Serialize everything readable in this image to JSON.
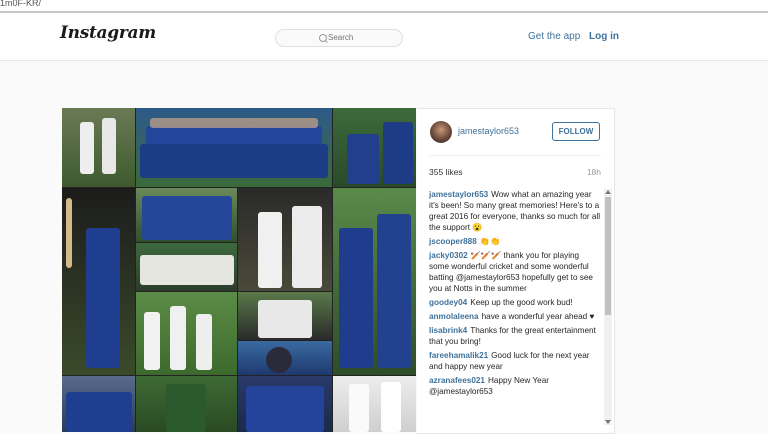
{
  "browser": {
    "url_fragment": "1m0F-KR/"
  },
  "header": {
    "logo": "Instagram",
    "search_placeholder": "Search",
    "get_app": "Get the app",
    "login": "Log in"
  },
  "post": {
    "username": "jamestaylor653",
    "follow_label": "FOLLOW",
    "likes": "355 likes",
    "age": "18h",
    "comments": [
      {
        "user": "jamestaylor653",
        "text": "Wow what an amazing year it's been! So many great memories! Here's to a great 2016 for everyone, thanks so much for all the support 😮"
      },
      {
        "user": "jscooper888",
        "text": "👏👏"
      },
      {
        "user": "jacky0302",
        "text": "🏏🏏🏏 thank you for playing some wonderful cricket and some wonderful batting @jamestaylor653 hopefully get to see you at Notts in the summer"
      },
      {
        "user": "goodey04",
        "text": "Keep up the good work bud!"
      },
      {
        "user": "anmolaleena",
        "text": "have a wonderful year ahead ♥"
      },
      {
        "user": "lisabrink4",
        "text": "Thanks for the great entertainment that you bring!"
      },
      {
        "user": "fareehamalik21",
        "text": "Good luck for the next year and happy new year"
      },
      {
        "user": "azranafees021",
        "text": "Happy New Year @jamestaylor653"
      }
    ]
  },
  "colors": {
    "link": "#3f729b",
    "navy_kit": "#1f3f8f",
    "whites": "#f2f2f2",
    "grass": "#4f8a3a"
  }
}
